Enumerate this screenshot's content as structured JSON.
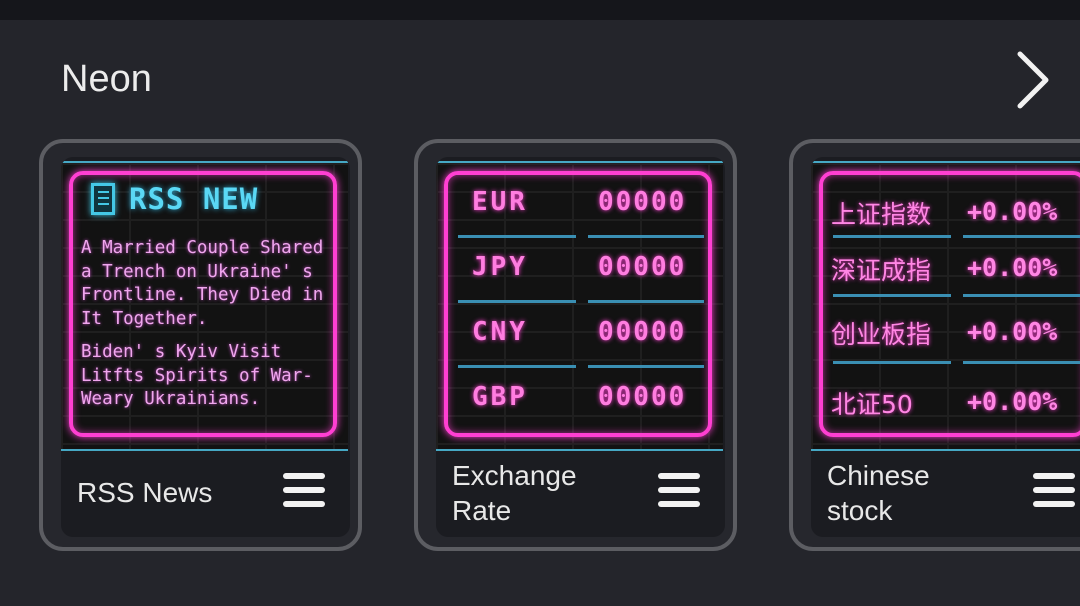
{
  "section": {
    "title": "Neon"
  },
  "cards": [
    {
      "label": "RSS News",
      "widget": {
        "title": "RSS NEW",
        "items": [
          "A Married Couple Shared a Trench on Ukraine' s Frontline. They Died in It Together.",
          "Biden' s Kyiv Visit Litfts Spirits of War-Weary Ukrainians."
        ]
      }
    },
    {
      "label": "Exchange Rate",
      "label_lines": [
        "Exchange",
        "Rate"
      ],
      "widget": {
        "rows": [
          {
            "code": "EUR",
            "value": "00000"
          },
          {
            "code": "JPY",
            "value": "00000"
          },
          {
            "code": "CNY",
            "value": "00000"
          },
          {
            "code": "GBP",
            "value": "00000"
          }
        ]
      }
    },
    {
      "label": "Chinese stock",
      "label_lines": [
        "Chinese",
        "stock"
      ],
      "widget": {
        "rows": [
          {
            "name": "上证指数",
            "change": "+0.00%"
          },
          {
            "name": "深证成指",
            "change": "+0.00%"
          },
          {
            "name": "创业板指",
            "change": "+0.00%"
          },
          {
            "name": "北证50",
            "change": "+0.00%"
          }
        ]
      }
    }
  ],
  "icons": {
    "next": "chevron-right-icon",
    "menu": "menu-icon",
    "rss": "document-icon"
  },
  "colors": {
    "background": "#24252b",
    "neon_pink": "#ff3fd2",
    "neon_cyan": "#44c8e6",
    "card_border": "#5c5d62"
  }
}
